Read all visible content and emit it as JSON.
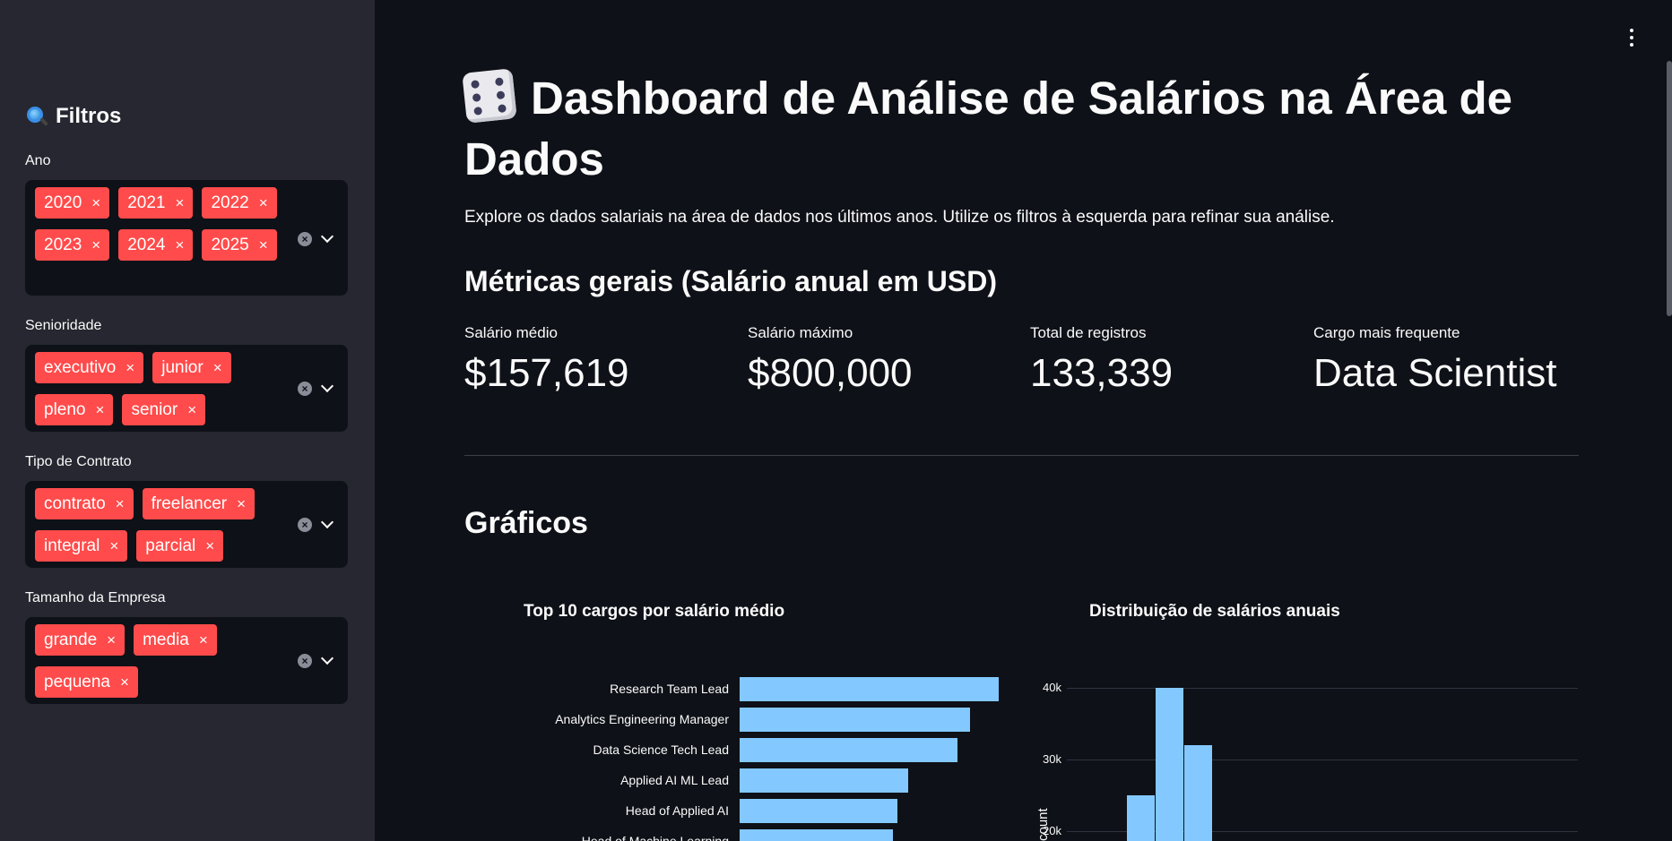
{
  "sidebar": {
    "title": "Filtros",
    "filters": [
      {
        "label": "Ano",
        "chips": [
          "2020",
          "2021",
          "2022",
          "2023",
          "2024",
          "2025"
        ]
      },
      {
        "label": "Senioridade",
        "chips": [
          "executivo",
          "junior",
          "pleno",
          "senior"
        ]
      },
      {
        "label": "Tipo de Contrato",
        "chips": [
          "contrato",
          "freelancer",
          "integral",
          "parcial"
        ]
      },
      {
        "label": "Tamanho da Empresa",
        "chips": [
          "grande",
          "media",
          "pequena"
        ]
      }
    ]
  },
  "main": {
    "title": "Dashboard de Análise de Salários na Área de Dados",
    "description": "Explore os dados salariais na área de dados nos últimos anos. Utilize os filtros à esquerda para refinar sua análise.",
    "metrics_heading": "Métricas gerais (Salário anual em USD)",
    "metrics": [
      {
        "label": "Salário médio",
        "value": "$157,619"
      },
      {
        "label": "Salário máximo",
        "value": "$800,000"
      },
      {
        "label": "Total de registros",
        "value": "133,339"
      },
      {
        "label": "Cargo mais frequente",
        "value": "Data Scientist"
      }
    ],
    "charts_heading": "Gráficos"
  },
  "icons": {
    "sidebar_title": "magnifier-icon",
    "page_title": "dice-icon",
    "clear": "clear-x-icon",
    "dropdown": "chevron-down-icon",
    "menu": "kebab-menu-icon"
  },
  "colors": {
    "accent": "#ff4b4b",
    "bar": "#83c9ff",
    "background": "#0e1117",
    "sidebar": "#262730"
  },
  "chart_data": [
    {
      "type": "bar",
      "orientation": "horizontal",
      "title": "Top 10 cargos por salário médio",
      "categories": [
        "Research Team Lead",
        "Analytics Engineering Manager",
        "Data Science Tech Lead",
        "Applied AI ML Lead",
        "Head of Applied AI",
        "Head of Machine Learning"
      ],
      "values": [
        100,
        89,
        84,
        65,
        61,
        59
      ],
      "note_values_relative": true
    },
    {
      "type": "bar",
      "title": "Distribuição de salários anuais",
      "ylabel": "count",
      "yticks": [
        "20k",
        "30k",
        "40k"
      ],
      "ylim": [
        20000,
        40000
      ],
      "values": [
        25000,
        40000,
        32000
      ]
    }
  ]
}
